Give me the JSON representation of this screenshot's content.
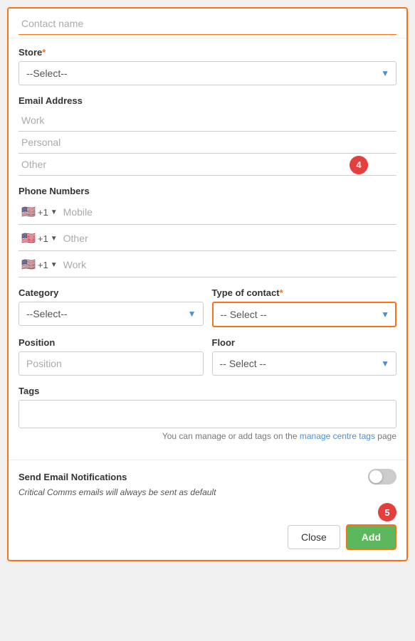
{
  "form": {
    "contact_name_placeholder": "Contact name",
    "store_label": "Store",
    "store_required": "*",
    "store_default": "--Select--",
    "email_label": "Email Address",
    "email_work_placeholder": "Work",
    "email_personal_placeholder": "Personal",
    "email_other_placeholder": "Other",
    "phone_label": "Phone Numbers",
    "phone_country_code": "+1",
    "phone_mobile_placeholder": "Mobile",
    "phone_other_placeholder": "Other",
    "phone_work_placeholder": "Work",
    "category_label": "Category",
    "category_default": "--Select--",
    "type_of_contact_label": "Type of contact",
    "type_of_contact_required": "*",
    "type_of_contact_default": "-- Select --",
    "position_label": "Position",
    "position_placeholder": "Position",
    "floor_label": "Floor",
    "floor_default": "-- Select --",
    "tags_label": "Tags",
    "tags_placeholder": "",
    "tags_hint": "You can manage or add tags on the",
    "tags_hint_link": "manage centre tags",
    "tags_hint_suffix": "page",
    "notifications_label": "Send Email Notifications",
    "notifications_hint": "Critical Comms emails will always be sent as default",
    "btn_close": "Close",
    "btn_add": "Add",
    "step_4_badge": "4",
    "step_5_badge": "5"
  }
}
